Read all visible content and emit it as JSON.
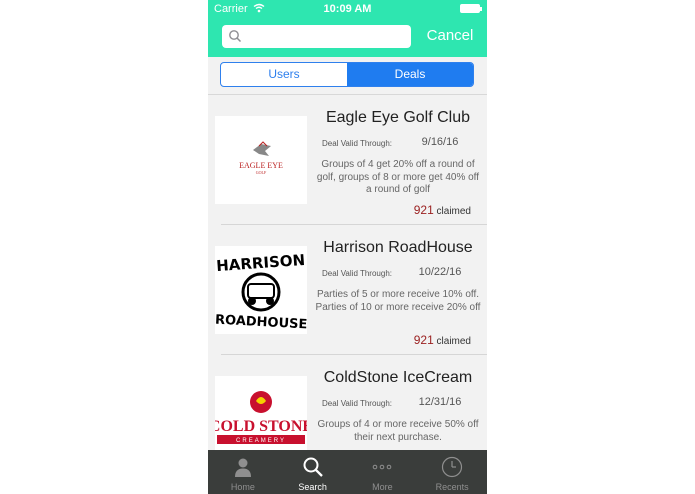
{
  "status": {
    "carrier": "Carrier",
    "time": "10:09 AM"
  },
  "search": {
    "placeholder": "",
    "value": "",
    "cancel_label": "Cancel"
  },
  "segments": [
    {
      "label": "Users",
      "active": false
    },
    {
      "label": "Deals",
      "active": true
    }
  ],
  "deals": [
    {
      "title": "Eagle Eye Golf Club",
      "valid_label": "Deal Valid Through:",
      "valid_date": "9/16/16",
      "description": "Groups of 4 get 20% off a round of golf, groups of 8 or more get 40% off a round of golf",
      "claimed_count": "921",
      "claimed_label": "claimed",
      "logo_text": "EAGLE EYE",
      "logo_subtext": "GOLF"
    },
    {
      "title": "Harrison RoadHouse",
      "valid_label": "Deal Valid Through:",
      "valid_date": "10/22/16",
      "description": "Parties of 5 or more receive 10% off.  Parties of 10 or more receive 20% off",
      "claimed_count": "921",
      "claimed_label": "claimed",
      "logo_text": "HARRISON",
      "logo_subtext": "ROADHOUSE"
    },
    {
      "title": "ColdStone IceCream",
      "valid_label": "Deal Valid Through:",
      "valid_date": "12/31/16",
      "description": "Groups of 4 or more receive 50% off their next purchase.",
      "claimed_count": "",
      "claimed_label": "",
      "logo_text": "COLD STONE",
      "logo_subtext": "CREAMERY"
    }
  ],
  "tabs": [
    {
      "label": "Home",
      "icon": "person-icon"
    },
    {
      "label": "Search",
      "icon": "search-icon"
    },
    {
      "label": "More",
      "icon": "more-icon"
    },
    {
      "label": "Recents",
      "icon": "clock-icon"
    }
  ],
  "colors": {
    "header": "#2ee6b0",
    "segment_accent": "#1f7cf0",
    "tabbar": "#3a3d3b",
    "claimed_count": "#9a1f1f"
  }
}
